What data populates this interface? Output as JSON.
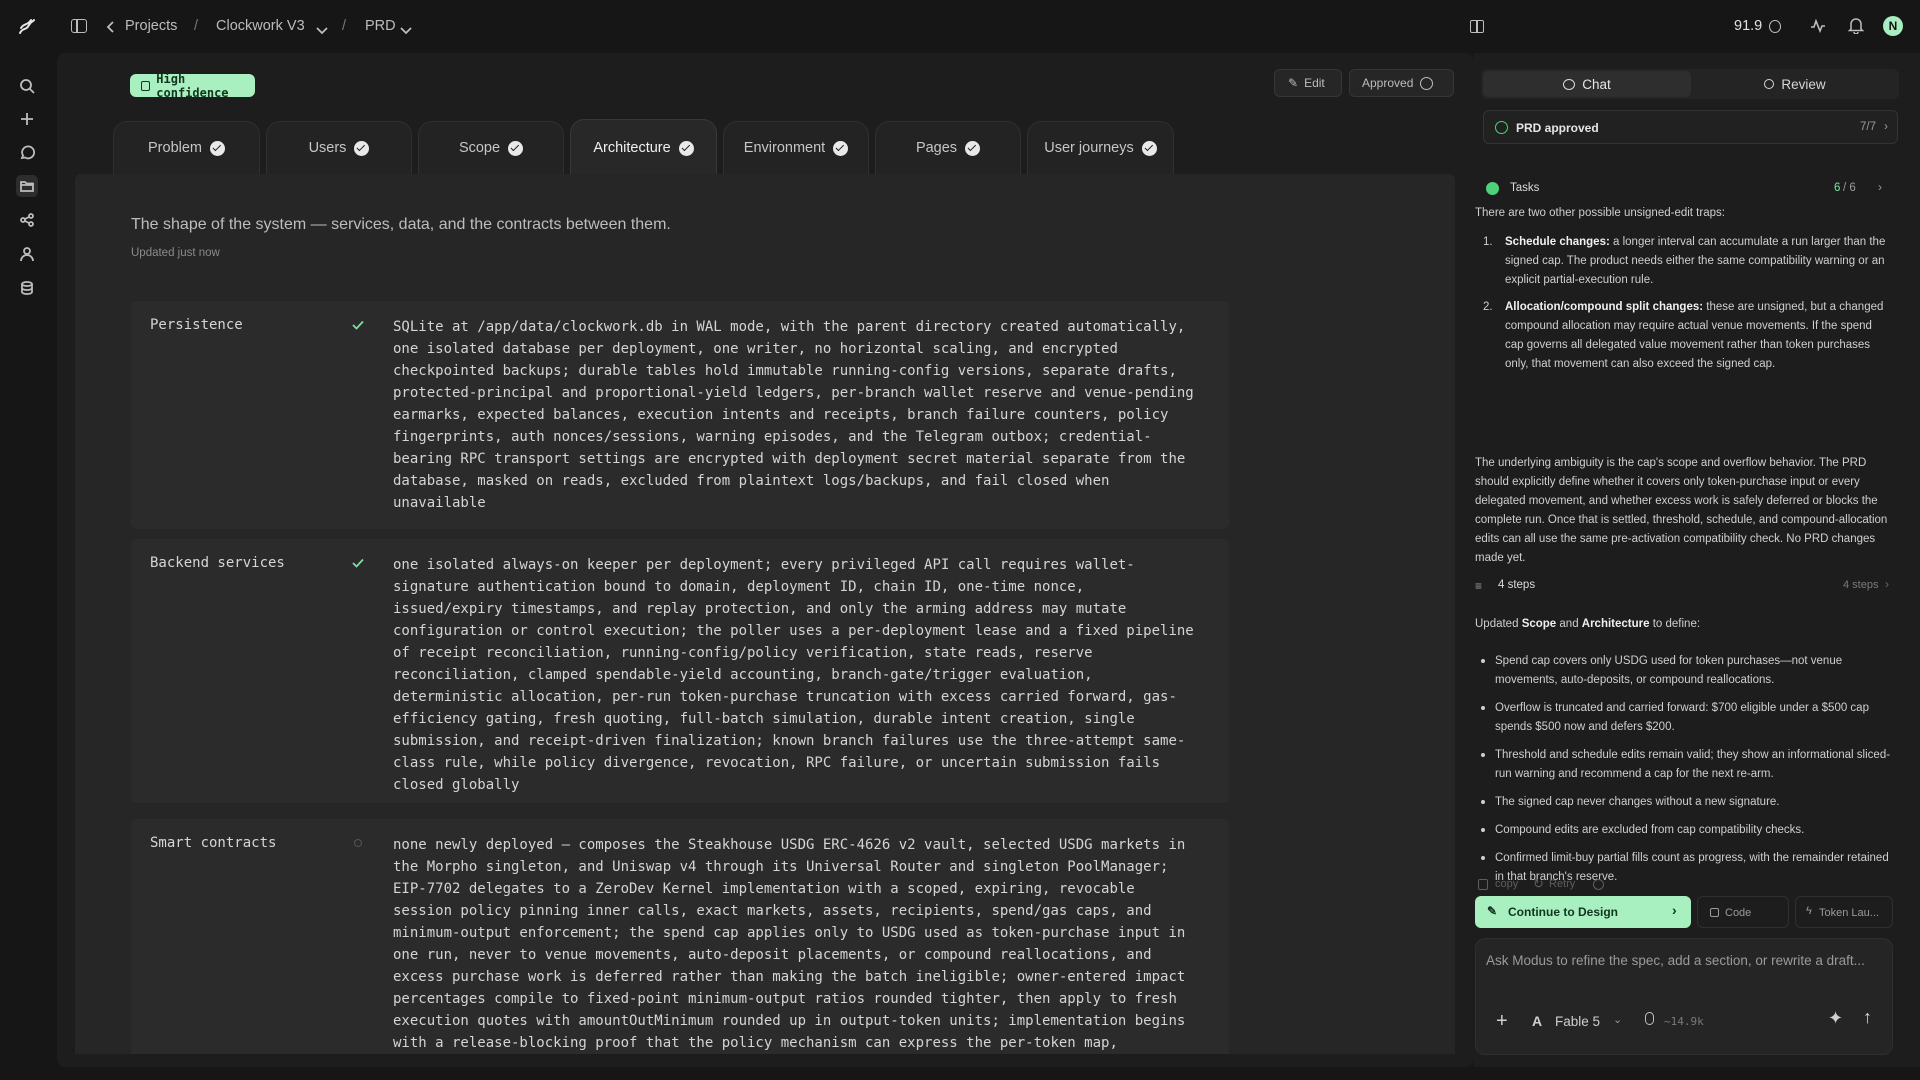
{
  "header": {
    "projects_label": "Projects",
    "project_name": "Clockwork V3",
    "doc_name": "PRD",
    "sep1": "/",
    "sep2": "/",
    "credits": "91.9",
    "avatar_initial": "N"
  },
  "toolbar": {
    "confidence_label": "High confidence",
    "edit_label": "Edit",
    "approved_label": "Approved"
  },
  "tabs": [
    {
      "label": "Problem"
    },
    {
      "label": "Users"
    },
    {
      "label": "Scope"
    },
    {
      "label": "Architecture"
    },
    {
      "label": "Environment"
    },
    {
      "label": "Pages"
    },
    {
      "label": "User journeys"
    }
  ],
  "section": {
    "subtitle": "The shape of the system — services, data, and the contracts between them.",
    "updated": "Updated just now"
  },
  "rows": [
    {
      "label": "Persistence",
      "text": "SQLite at /app/data/clockwork.db in WAL mode, with the parent directory created automatically,\none isolated database per deployment, one writer, no horizontal scaling, and encrypted\ncheckpointed backups; durable tables hold immutable running-config versions, separate drafts,\nprotected-principal and proportional-yield ledgers, per-branch wallet reserve and venue-pending\nearmarks, expected balances, execution intents and receipts, branch failure counters, policy\nfingerprints, auth nonces/sessions, warning episodes, and the Telegram outbox; credential-\nbearing RPC transport settings are encrypted with deployment secret material separate from the\ndatabase, masked on reads, excluded from plaintext logs/backups, and fail closed when\nunavailable"
    },
    {
      "label": "Backend services",
      "text": "one isolated always-on keeper per deployment; every privileged API call requires wallet-\nsignature authentication bound to domain, deployment ID, chain ID, one-time nonce,\nissued/expiry timestamps, and replay protection, and only the arming address may mutate\nconfiguration or control execution; the poller uses a per-deployment lease and a fixed pipeline\nof receipt reconciliation, running-config/policy verification, state reads, reserve\nreconciliation, clamped spendable-yield accounting, branch-gate/trigger evaluation,\ndeterministic allocation, per-run token-purchase truncation with excess carried forward, gas-\nefficiency gating, fresh quoting, full-batch simulation, durable intent creation, single\nsubmission, and receipt-driven finalization; known branch failures use the three-attempt same-\nclass rule, while policy divergence, revocation, RPC failure, or uncertain submission fails\nclosed globally"
    },
    {
      "label": "Smart contracts",
      "text": "none newly deployed — composes the Steakhouse USDG ERC-4626 v2 vault, selected USDG markets in\nthe Morpho singleton, and Uniswap v4 through its Universal Router and singleton PoolManager;\nEIP-7702 delegates to a ZeroDev Kernel implementation with a scoped, expiring, revocable\nsession policy pinning inner calls, exact markets, assets, recipients, spend/gas caps, and\nminimum-output enforcement; the spend cap applies only to USDG used as token-purchase input in\none run, never to venue movements, auto-deposit placements, or compound reallocations, and\nexcess purchase work is deferred rather than making the batch ineligible; owner-entered impact\npercentages compile to fixed-point minimum-output ratios rounded tighter, then apply to fresh\nexecution quotes with amountOutMinimum rounded up in output-token units; implementation begins\nwith a release-blocking proof that the policy mechanism can express the per-token map,"
    }
  ],
  "side": {
    "chat_tab": "Chat",
    "review_tab": "Review",
    "prd_status": "PRD approved",
    "prd_count": "7/7",
    "tasks_label": "Tasks",
    "tasks_done": "6",
    "tasks_total": "/ 6",
    "intro": "There are two other possible unsigned-edit traps:",
    "traps": [
      {
        "n": "1.",
        "title": "Schedule changes:",
        "text": " a longer interval can accumulate a run larger than the signed cap. The product needs either the same compatibility warning or an explicit partial-execution rule."
      },
      {
        "n": "2.",
        "title": "Allocation/compound split changes:",
        "text": " these are unsigned, but a changed compound allocation may require actual venue movements. If the spend cap governs all delegated value movement rather than token purchases only, that movement can also exceed the signed cap."
      }
    ],
    "para": "The underlying ambiguity is the cap's scope and overflow behavior. The PRD should explicitly define whether it covers only token-purchase input or every delegated movement, and whether excess work is safely deferred or blocks the complete run. Once that is settled, threshold, schedule, and compound-allocation edits can all use the same pre-activation compatibility check. No PRD changes made yet.",
    "steps_label": "4 steps",
    "steps_right": "4 steps",
    "upd_a": "Updated ",
    "upd_b": "Scope",
    "upd_c": " and ",
    "upd_d": "Architecture",
    "upd_e": " to define:",
    "bullets": [
      "Spend cap covers only USDG used for token purchases—not venue movements, auto-deposits, or compound reallocations.",
      "Overflow is truncated and carried forward: $700 eligible under a $500 cap spends $500 now and defers $200.",
      "Threshold and schedule edits remain valid; they show an informational sliced-run warning and recommend a cap for the next re-arm.",
      "The signed cap never changes without a new signature.",
      "Compound edits are excluded from cap compatibility checks.",
      "Confirmed limit-buy partial fills count as progress, with the remainder retained in that branch's reserve."
    ],
    "copy": "copy",
    "retry": "Retry",
    "continue_label": "Continue to Design",
    "code_label": "Code",
    "token_label": "Token Lau...",
    "input_placeholder": "Ask Modus to refine the spec, add a section, or rewrite a draft...",
    "model": "Fable 5",
    "tokens": "~14.9k"
  },
  "colors": {
    "accent_green": "#7ee0a1",
    "confidence_bg": "#a9f0c0",
    "approved_green": "#4fd07c"
  }
}
